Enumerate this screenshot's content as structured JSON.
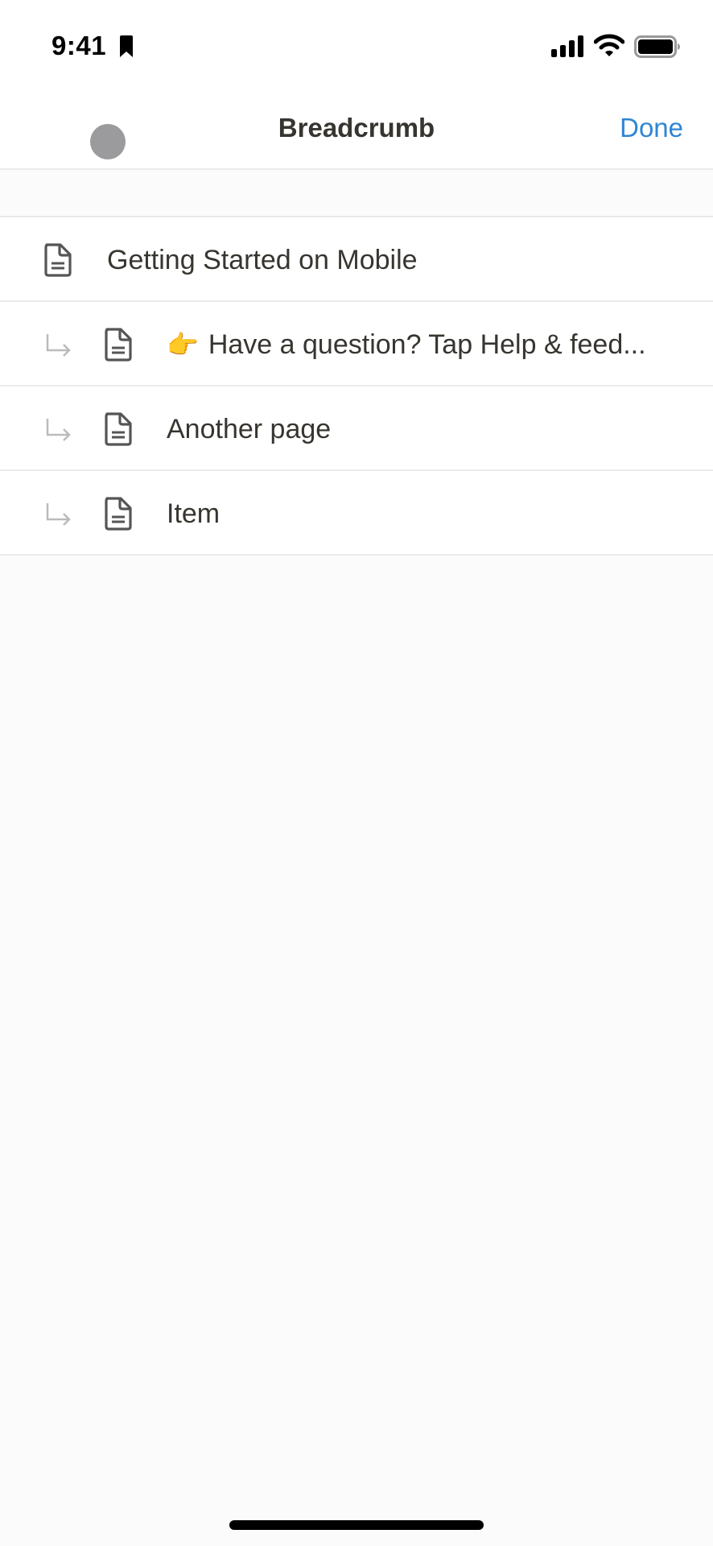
{
  "status_bar": {
    "time": "9:41",
    "icons": [
      "bookmark-icon",
      "signal-icon",
      "wifi-icon",
      "battery-icon"
    ]
  },
  "nav": {
    "title": "Breadcrumb",
    "done_label": "Done",
    "accent": "#2f86d3"
  },
  "breadcrumb": {
    "items": [
      {
        "label": "Getting Started on Mobile",
        "level": 0,
        "icon": "page-icon"
      },
      {
        "emoji": "👉",
        "label": "Have a question? Tap Help & feed...",
        "level": 1,
        "icon": "page-icon"
      },
      {
        "label": "Another page",
        "level": 1,
        "icon": "page-icon"
      },
      {
        "label": "Item",
        "level": 1,
        "icon": "page-icon"
      }
    ]
  }
}
